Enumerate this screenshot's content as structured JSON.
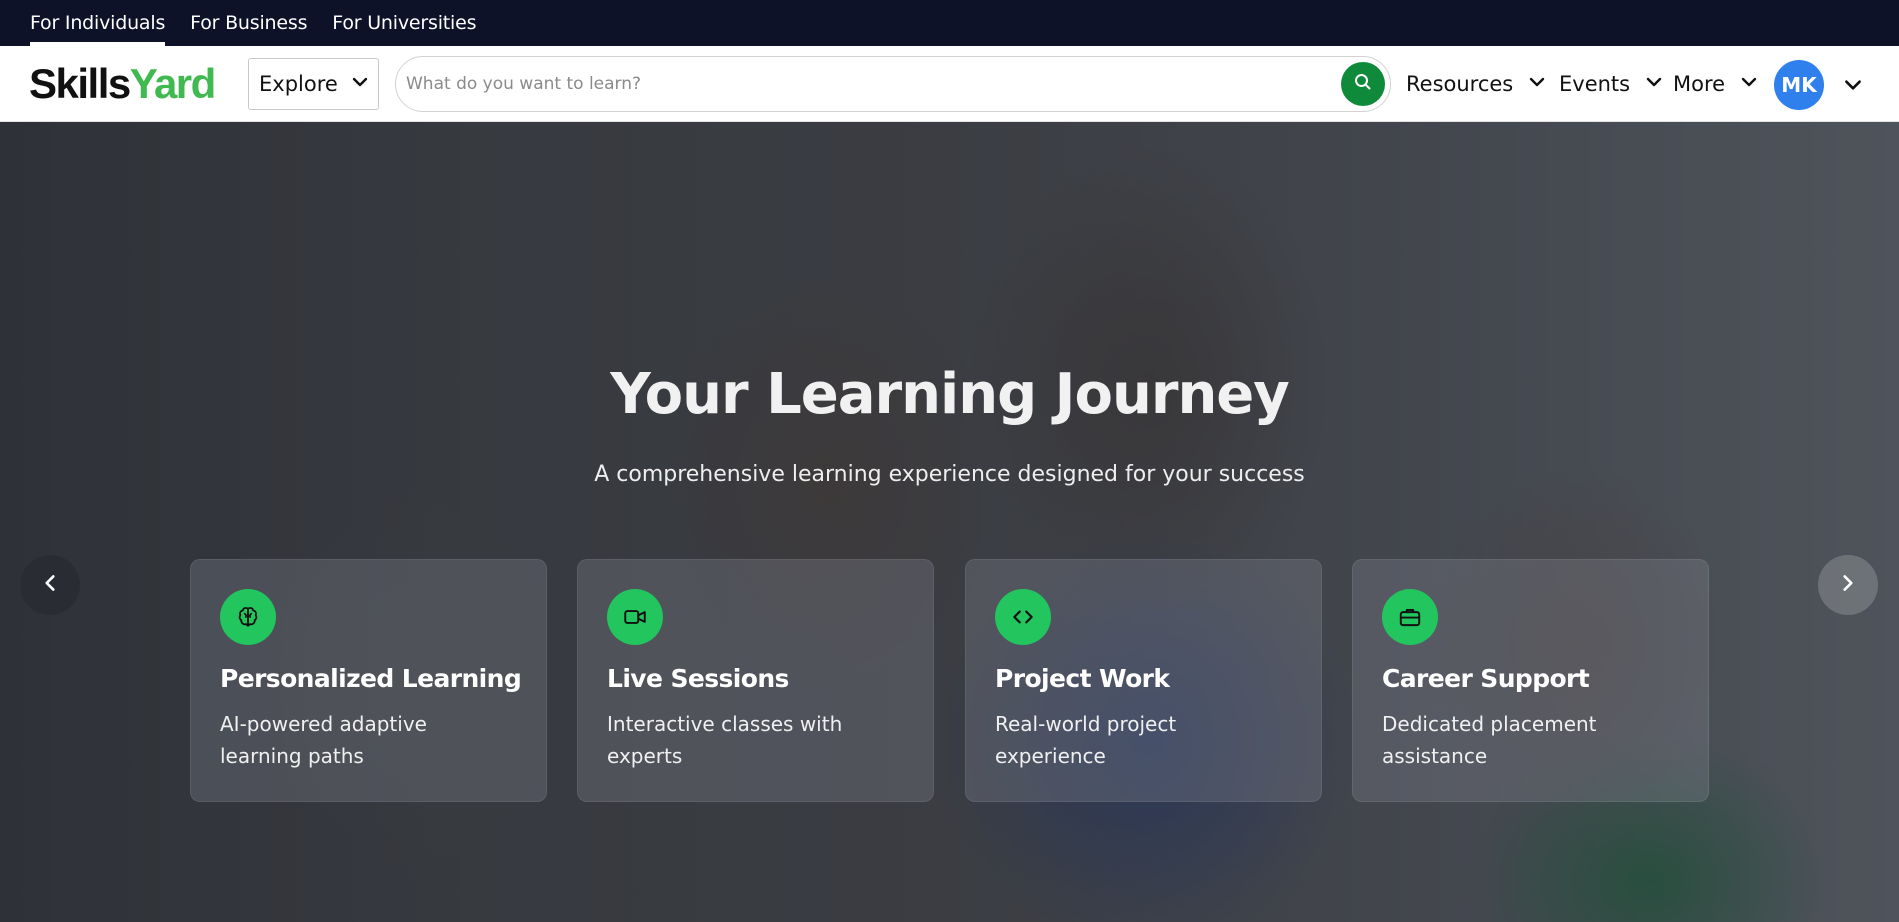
{
  "audience_tabs": [
    {
      "label": "For Individuals",
      "active": true
    },
    {
      "label": "For Business",
      "active": false
    },
    {
      "label": "For Universities",
      "active": false
    }
  ],
  "header": {
    "logo_part1": "Skills",
    "logo_part2": "Yard",
    "explore_label": "Explore",
    "search_placeholder": "What do you want to learn?",
    "nav": [
      "Resources",
      "Events",
      "More"
    ],
    "avatar_initials": "MK"
  },
  "hero": {
    "title": "Your Learning Journey",
    "subtitle": "A comprehensive learning experience designed for your success",
    "cards": [
      {
        "icon": "brain-icon",
        "title": "Personalized Learning",
        "description": "AI-powered adaptive learning paths"
      },
      {
        "icon": "video-icon",
        "title": "Live Sessions",
        "description": "Interactive classes with experts"
      },
      {
        "icon": "code-icon",
        "title": "Project Work",
        "description": "Real-world project experience"
      },
      {
        "icon": "briefcase-icon",
        "title": "Career Support",
        "description": "Dedicated placement assistance"
      }
    ]
  },
  "colors": {
    "brand_green": "#3fb950",
    "search_button": "#0f8a3a",
    "card_icon_bg": "#22c55e",
    "avatar_bg": "#2f80ed",
    "top_bar": "#0d1228"
  }
}
